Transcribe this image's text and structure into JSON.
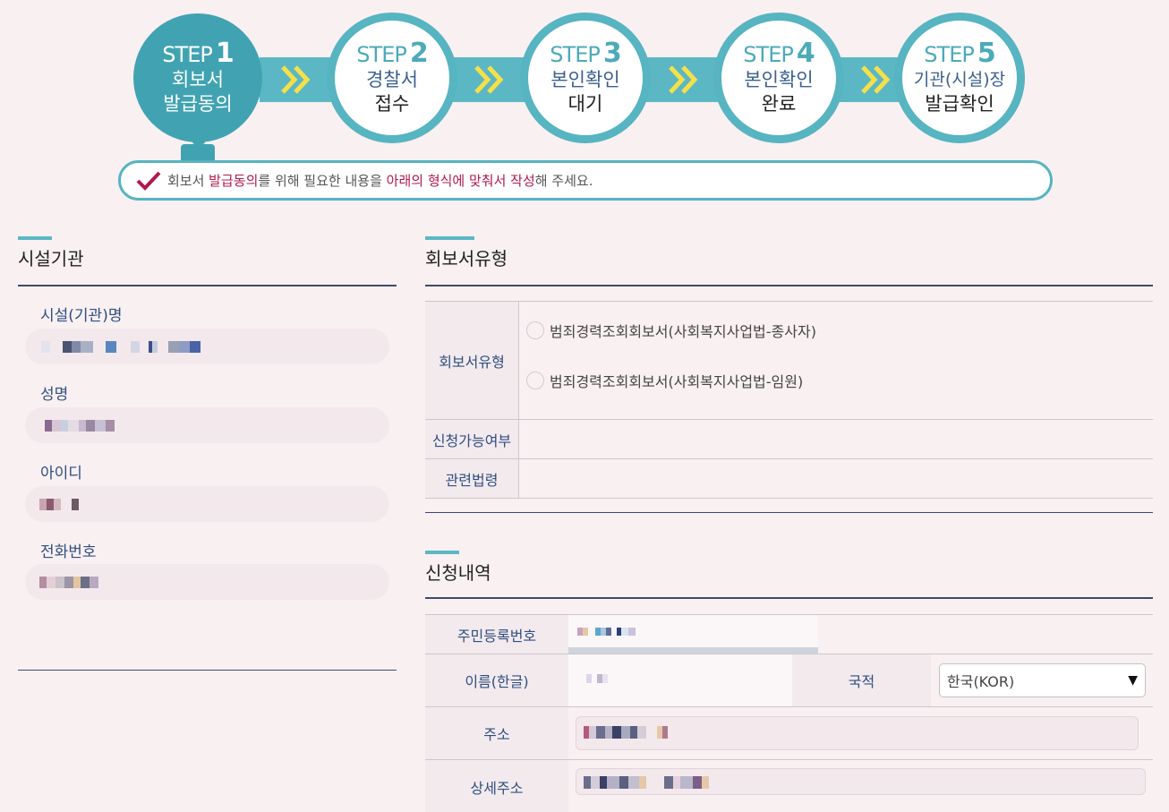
{
  "stepper": {
    "steps": [
      {
        "word": "STEP",
        "num": "1",
        "line1": "회보서",
        "line2": "발급동의",
        "active": true
      },
      {
        "word": "STEP",
        "num": "2",
        "line1": "경찰서",
        "line2": "접수",
        "active": false
      },
      {
        "word": "STEP",
        "num": "3",
        "line1": "본인확인",
        "line2": "대기",
        "active": false
      },
      {
        "word": "STEP",
        "num": "4",
        "line1": "본인확인",
        "line2": "완료",
        "active": false
      },
      {
        "word": "STEP",
        "num": "5",
        "line1": "기관(시설)장",
        "line2": "발급확인",
        "active": false
      }
    ],
    "notice": {
      "part1": "회보서 ",
      "em1": "발급동의",
      "part2": "를 위해 필요한 내용을 ",
      "em2": "아래의 형식에 맞춰서 작성",
      "part3": "해 주세요."
    }
  },
  "facility": {
    "title": "시설기관",
    "fields": [
      {
        "label": "시설(기관)명"
      },
      {
        "label": "성명"
      },
      {
        "label": "아이디"
      },
      {
        "label": "전화번호"
      }
    ]
  },
  "report_type": {
    "title": "회보서유형",
    "row_label": "회보서유형",
    "options": [
      "범죄경력조회회보서(사회복지사업법-종사자)",
      "범죄경력조회회보서(사회복지사업법-임원)"
    ],
    "availability_label": "신청가능여부",
    "law_label": "관련법령"
  },
  "application": {
    "title": "신청내역",
    "rrn_label": "주민등록번호",
    "name_label": "이름(한글)",
    "nationality_label": "국적",
    "nationality_value": "한국(KOR)",
    "address_label": "주소",
    "detail_address_label": "상세주소"
  },
  "colors": {
    "accent": "#57b4c1",
    "active_step": "#41a3b2",
    "emphasis": "#b0194d",
    "label": "#2f4f7f",
    "chevron": "#f5e04a"
  }
}
